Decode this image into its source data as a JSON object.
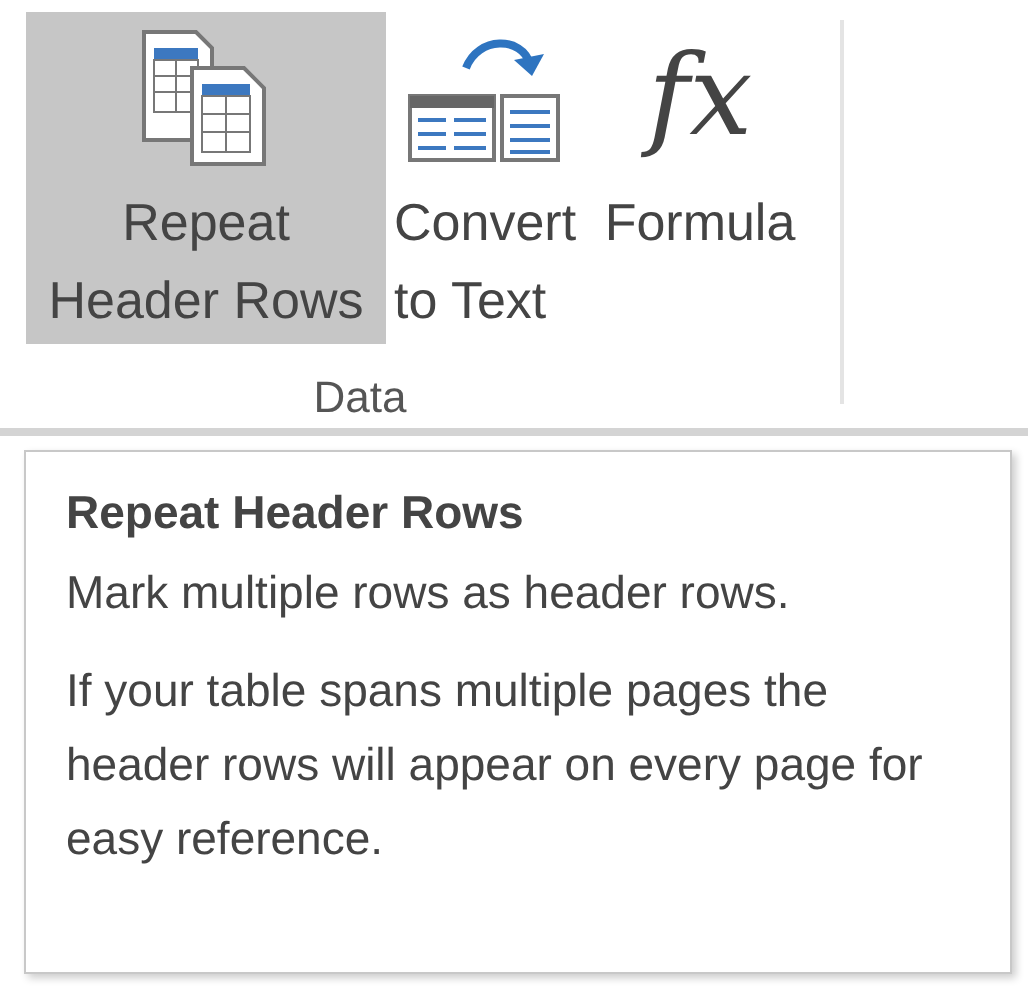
{
  "ribbon": {
    "buttons": [
      {
        "kind": "repeat-header",
        "label": "Repeat Header Rows",
        "selected": true
      },
      {
        "kind": "convert",
        "label": "Convert to Text",
        "selected": false
      },
      {
        "kind": "formula",
        "label": "Formula",
        "glyph": "fx",
        "selected": false
      }
    ],
    "group_label": "Data"
  },
  "tooltip": {
    "title": "Repeat Header Rows",
    "paragraphs": [
      "Mark multiple rows as header rows.",
      "If your table spans multiple pages the header rows will appear on every page for easy reference."
    ]
  }
}
